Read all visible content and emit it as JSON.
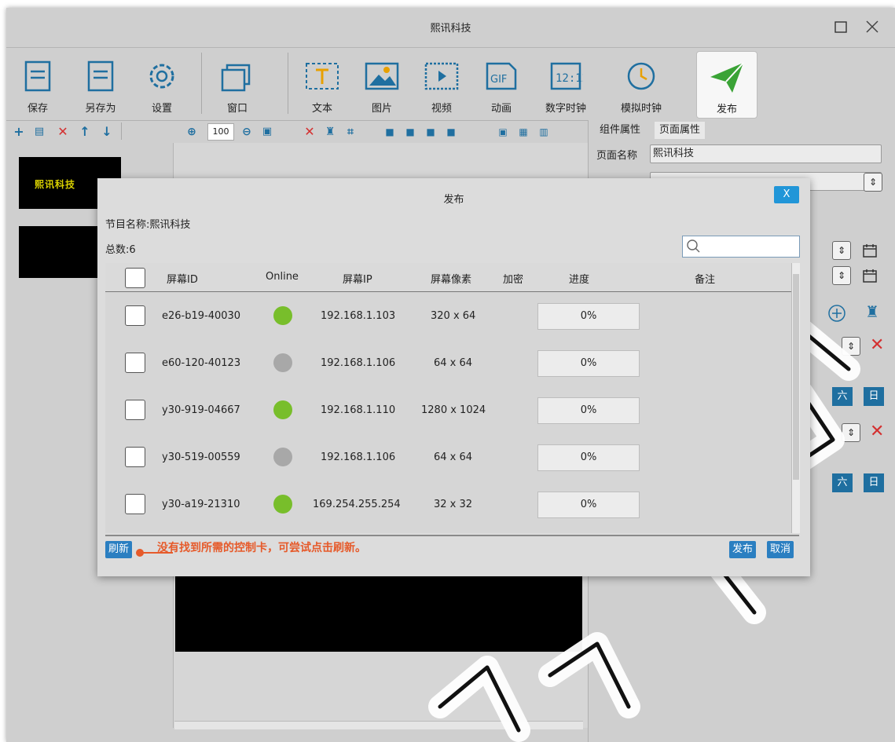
{
  "app": {
    "title": "熙讯科技"
  },
  "toolbar": {
    "items": [
      {
        "label": "保存",
        "icon": "save-icon"
      },
      {
        "label": "另存为",
        "icon": "save-as-icon"
      },
      {
        "label": "设置",
        "icon": "gear-icon"
      },
      {
        "label": "窗口",
        "icon": "window-icon"
      },
      {
        "label": "文本",
        "icon": "text-icon"
      },
      {
        "label": "图片",
        "icon": "image-icon"
      },
      {
        "label": "视频",
        "icon": "video-icon"
      },
      {
        "label": "动画",
        "icon": "gif-icon"
      },
      {
        "label": "数字时钟",
        "icon": "digital-clock-icon"
      },
      {
        "label": "模拟时钟",
        "icon": "analog-clock-icon"
      },
      {
        "label": "发布",
        "icon": "send-icon"
      }
    ]
  },
  "subbar": {
    "zoom": "100"
  },
  "left_panel": {
    "thumb_text": "熙讯科技"
  },
  "right_panel": {
    "tabs": [
      "组件属性",
      "页面属性"
    ],
    "page_name_label": "页面名称",
    "page_name_value": "熙讯科技",
    "day_button": "六",
    "day_button2": "日"
  },
  "dialog": {
    "title": "发布",
    "close_label": "X",
    "program_name": "节目名称:熙讯科技",
    "total": "总数:6",
    "search_placeholder": "",
    "columns": [
      "屏幕ID",
      "Online",
      "屏幕IP",
      "屏幕像素",
      "加密",
      "进度",
      "备注"
    ],
    "rows": [
      {
        "id": "e26-b19-40030",
        "online": true,
        "ip": "192.168.1.103",
        "pixels": "320 x 64",
        "progress": "0%"
      },
      {
        "id": "e60-120-40123",
        "online": false,
        "ip": "192.168.1.106",
        "pixels": "64 x 64",
        "progress": "0%"
      },
      {
        "id": "y30-919-04667",
        "online": true,
        "ip": "192.168.1.110",
        "pixels": "1280 x 1024",
        "progress": "0%"
      },
      {
        "id": "y30-519-00559",
        "online": false,
        "ip": "192.168.1.106",
        "pixels": "64 x 64",
        "progress": "0%"
      },
      {
        "id": "y30-a19-21310",
        "online": true,
        "ip": "169.254.255.254",
        "pixels": "32 x 32",
        "progress": "0%"
      }
    ],
    "refresh_label": "刷新",
    "hint": "没有找到所需的控制卡，可尝试点击刷新。",
    "publish_label": "发布",
    "cancel_label": "取消"
  },
  "colors": {
    "online": "#78be2b",
    "offline": "#a8a8a8",
    "accent": "#2196d8",
    "hint": "#e65a2a"
  }
}
